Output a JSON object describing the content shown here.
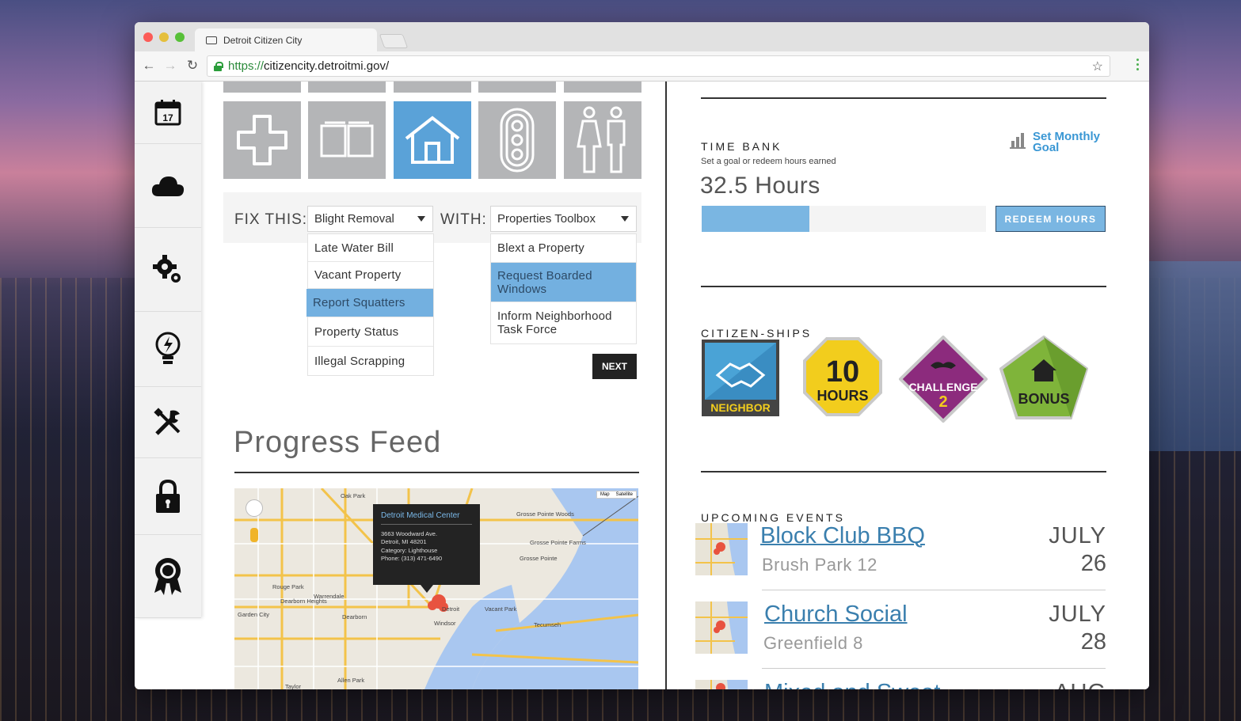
{
  "browser": {
    "tab_title": "Detroit Citizen City",
    "url_scheme": "https://",
    "url_host": "citizencity.detroitmi.gov/"
  },
  "sidebar": {
    "calendar_day": "17",
    "items": [
      "calendar",
      "cloud",
      "settings",
      "idea",
      "tools",
      "lock",
      "award"
    ]
  },
  "categories": [
    "health",
    "education",
    "housing",
    "traffic",
    "community"
  ],
  "fix_form": {
    "fix_label": "FIX THIS:",
    "fix_selected": "Blight Removal",
    "fix_options": [
      "Late Water Bill",
      "Vacant Property",
      "Report Squatters",
      "Property Status",
      "Illegal Scrapping"
    ],
    "fix_highlighted": "Report Squatters",
    "with_label": "WITH:",
    "with_selected": "Properties Toolbox",
    "with_options": [
      "Blext a Property",
      "Request Boarded Windows",
      "Inform Neighborhood Task Force"
    ],
    "with_highlighted": "Request Boarded Windows",
    "next_label": "NEXT"
  },
  "progress_feed": {
    "title": "Progress Feed",
    "popup": {
      "name": "Detroit Medical Center",
      "address1": "3663 Woodward Ave.",
      "address2": "Detroit, MI 48201",
      "category": "Category: Lighthouse",
      "phone": "Phone: (313) 471-6490"
    },
    "map_type": [
      "Map",
      "Satellite"
    ],
    "map_labels": [
      "Oak Park",
      "Grosse Pointe Woods",
      "Grosse Pointe Farms",
      "Grosse Pointe",
      "Dearborn Heights",
      "Dearborn",
      "Detroit",
      "Windsor",
      "Garden City",
      "Rouge Park",
      "Warrendale",
      "Tecumseh",
      "Vacant Park",
      "Allen Park",
      "Taylor"
    ]
  },
  "time_bank": {
    "title": "TIME BANK",
    "subtitle": "Set a goal or redeem hours earned",
    "goal_line1": "Set Monthly",
    "goal_line2": "Goal",
    "hours": "32.5 Hours",
    "progress_fraction": 0.38,
    "redeem_label": "REDEEM HOURS"
  },
  "citizen_ships": {
    "title": "CITIZEN-SHIPS",
    "badges": [
      {
        "label": "NEIGHBOR",
        "color": "#4aa3d6"
      },
      {
        "big": "10",
        "label": "HOURS",
        "color": "#f2cd1d"
      },
      {
        "label": "CHALLENGE",
        "num": "2",
        "color": "#8c2b7d"
      },
      {
        "label": "BONUS",
        "color": "#7fb43a"
      }
    ]
  },
  "upcoming_events": {
    "title": "UPCOMING EVENTS",
    "events": [
      {
        "title": "Block Club BBQ",
        "location": "Brush Park 12",
        "month": "JULY",
        "day": "26"
      },
      {
        "title": "Church Social",
        "location": "Greenfield 8",
        "month": "JULY",
        "day": "28"
      },
      {
        "title": "Mixed and Sweat...",
        "location": "",
        "month": "AUG",
        "day": ""
      }
    ]
  },
  "colors": {
    "accent_blue": "#5aa2d8",
    "tile_gray": "#b4b5b7",
    "link_blue": "#3a7fae"
  }
}
